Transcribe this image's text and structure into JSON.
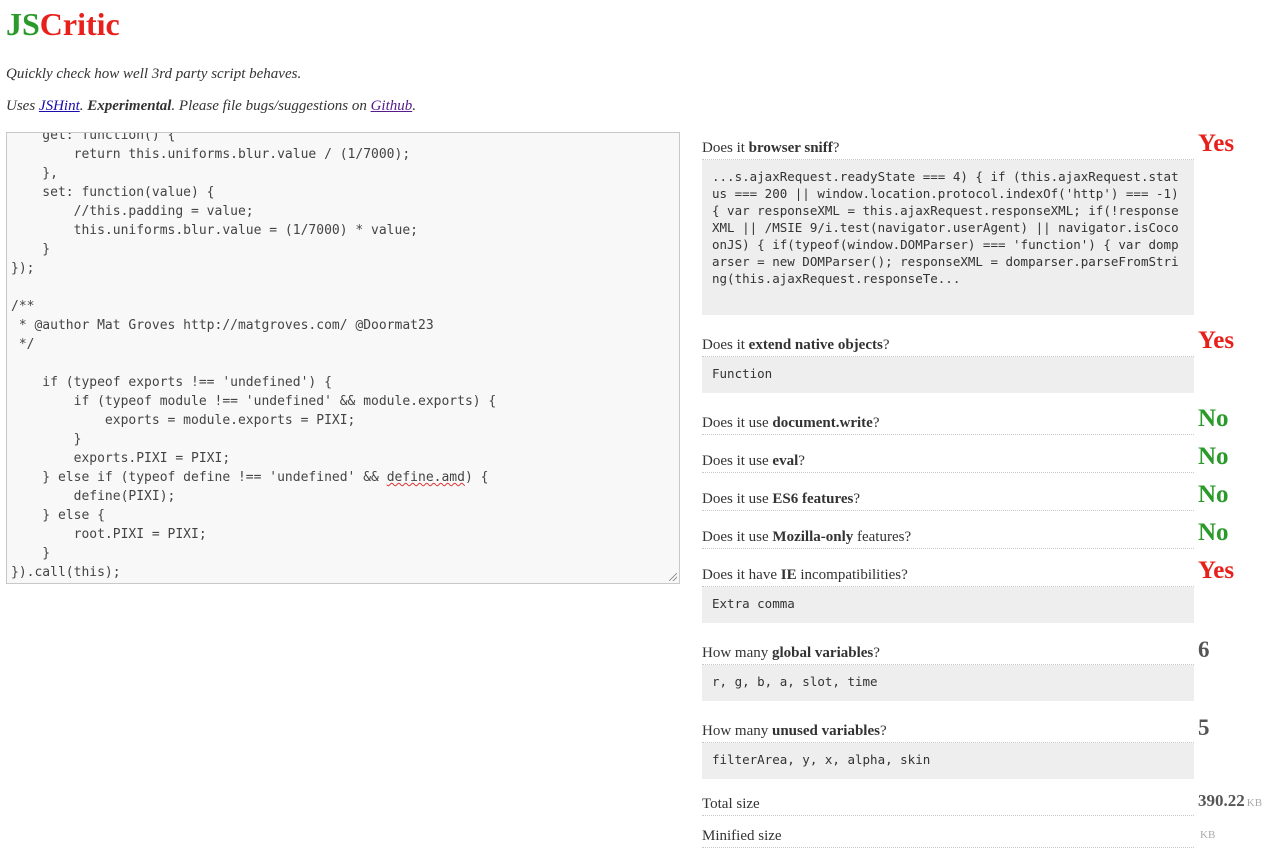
{
  "header": {
    "logo_js": "JS",
    "logo_critic": "Critic",
    "tagline": "Quickly check how well 3rd party script behaves.",
    "uses_prefix": "Uses ",
    "jshint_link": "JSHint",
    "uses_mid": ". ",
    "experimental": "Experimental",
    "uses_suffix": ". Please file bugs/suggestions on ",
    "github_link": "Github",
    "uses_end": "."
  },
  "editor": {
    "before_squiggle": "    get: function() {\n        return this.uniforms.blur.value / (1/7000);\n    },\n    set: function(value) {\n        //this.padding = value;\n        this.uniforms.blur.value = (1/7000) * value;\n    }\n});\n\n/**\n * @author Mat Groves http://matgroves.com/ @Doormat23\n */\n\n    if (typeof exports !== 'undefined') {\n        if (typeof module !== 'undefined' && module.exports) {\n            exports = module.exports = PIXI;\n        }\n        exports.PIXI = PIXI;\n    } else if (typeof define !== 'undefined' && ",
    "squiggle_word": "define.amd",
    "after_squiggle": ") {\n        define(PIXI);\n    } else {\n        root.PIXI = PIXI;\n    }\n}).call(this);"
  },
  "results": {
    "browser_sniff": {
      "q_pre": "Does it ",
      "q_bold": "browser sniff",
      "q_post": "?",
      "answer": "Yes",
      "detail": "...s.ajaxRequest.readyState === 4) { if (this.ajaxRequest.status === 200 || window.location.protocol.indexOf('http') === -1) { var responseXML = this.ajaxRequest.responseXML; if(!responseXML || /MSIE 9/i.test(navigator.userAgent) || navigator.isCocoonJS) { if(typeof(window.DOMParser) === 'function') { var domparser = new DOMParser(); responseXML = domparser.parseFromString(this.ajaxRequest.responseTe..."
    },
    "native_objects": {
      "q_pre": "Does it ",
      "q_bold": "extend native objects",
      "q_post": "?",
      "answer": "Yes",
      "detail": "Function"
    },
    "document_write": {
      "q_pre": "Does it use ",
      "q_bold": "document.write",
      "q_post": "?",
      "answer": "No"
    },
    "eval": {
      "q_pre": "Does it use ",
      "q_bold": "eval",
      "q_post": "?",
      "answer": "No"
    },
    "es6": {
      "q_pre": "Does it use ",
      "q_bold": "ES6 features",
      "q_post": "?",
      "answer": "No"
    },
    "mozilla": {
      "q_pre": "Does it use ",
      "q_bold": "Mozilla-only",
      "q_post": " features?",
      "answer": "No"
    },
    "ie": {
      "q_pre": "Does it have ",
      "q_bold": "IE",
      "q_post": " incompatibilities?",
      "answer": "Yes",
      "detail": "Extra comma"
    },
    "globals": {
      "q_pre": "How many ",
      "q_bold": "global variables",
      "q_post": "?",
      "answer": "6",
      "detail": "r, g, b, a, slot, time"
    },
    "unused": {
      "q_pre": "How many ",
      "q_bold": "unused variables",
      "q_post": "?",
      "answer": "5",
      "detail": "filterArea, y, x, alpha, skin"
    },
    "total_size": {
      "label": "Total size",
      "value": "390.22",
      "unit": "KB"
    },
    "minified_size": {
      "label": "Minified size",
      "value": "",
      "unit": "KB"
    }
  },
  "colors": {
    "yes": "#e8201c",
    "no": "#2a9a2a",
    "logo_js": "#2a9a2a",
    "logo_critic": "#e8201c"
  }
}
